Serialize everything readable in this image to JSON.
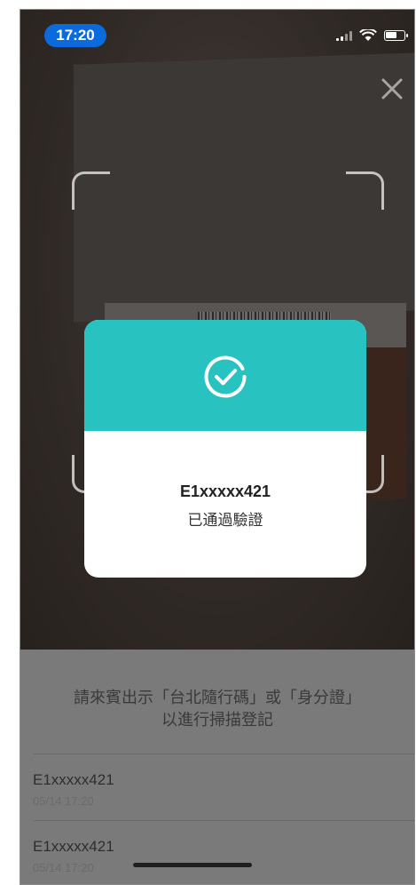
{
  "status_bar": {
    "time": "17:20"
  },
  "dialog": {
    "id": "E1xxxxx421",
    "message": "已通過驗證"
  },
  "sheet": {
    "instruction_line1": "請來賓出示「台北隨行碼」或「身分證」",
    "instruction_line2": "以進行掃描登記",
    "records": [
      {
        "id": "E1xxxxx421",
        "timestamp": "05/14 17:20"
      },
      {
        "id": "E1xxxxx421",
        "timestamp": "05/14 17:20"
      }
    ]
  },
  "colors": {
    "accent": "#28c3c0",
    "time_pill": "#0b6bdc"
  }
}
